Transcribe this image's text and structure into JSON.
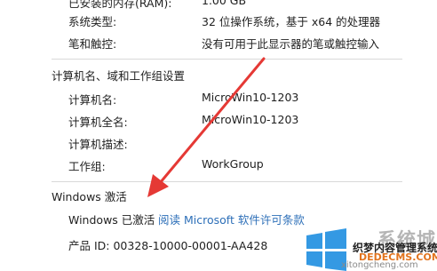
{
  "system": {
    "rows": [
      {
        "label": "已安装的内存(RAM):",
        "value": "1.00 GB"
      },
      {
        "label": "系统类型:",
        "value": "32 位操作系统，基于 x64 的处理器"
      },
      {
        "label": "笔和触控:",
        "value": "没有可用于此显示器的笔或触控输入"
      }
    ]
  },
  "computer": {
    "title": "计算机名、域和工作组设置",
    "rows": [
      {
        "label": "计算机名:",
        "value": "MicroWin10-1203"
      },
      {
        "label": "计算机全名:",
        "value": "MicroWin10-1203"
      },
      {
        "label": "计算机描述:",
        "value": ""
      },
      {
        "label": "工作组:",
        "value": "WorkGroup"
      }
    ]
  },
  "activation": {
    "title": "Windows 激活",
    "status": "Windows 已激活",
    "license_link": "阅读 Microsoft 软件许可条款",
    "product_id": "产品 ID: 00328-10000-00001-AA428"
  },
  "watermark": {
    "brand": "系统城",
    "site_name": "织梦内容管理系统",
    "site_domain": "DEDECMS.COM",
    "url": "xitongcheng.com"
  },
  "colors": {
    "annotation_arrow": "#e53935",
    "link": "#2d6fb8"
  }
}
